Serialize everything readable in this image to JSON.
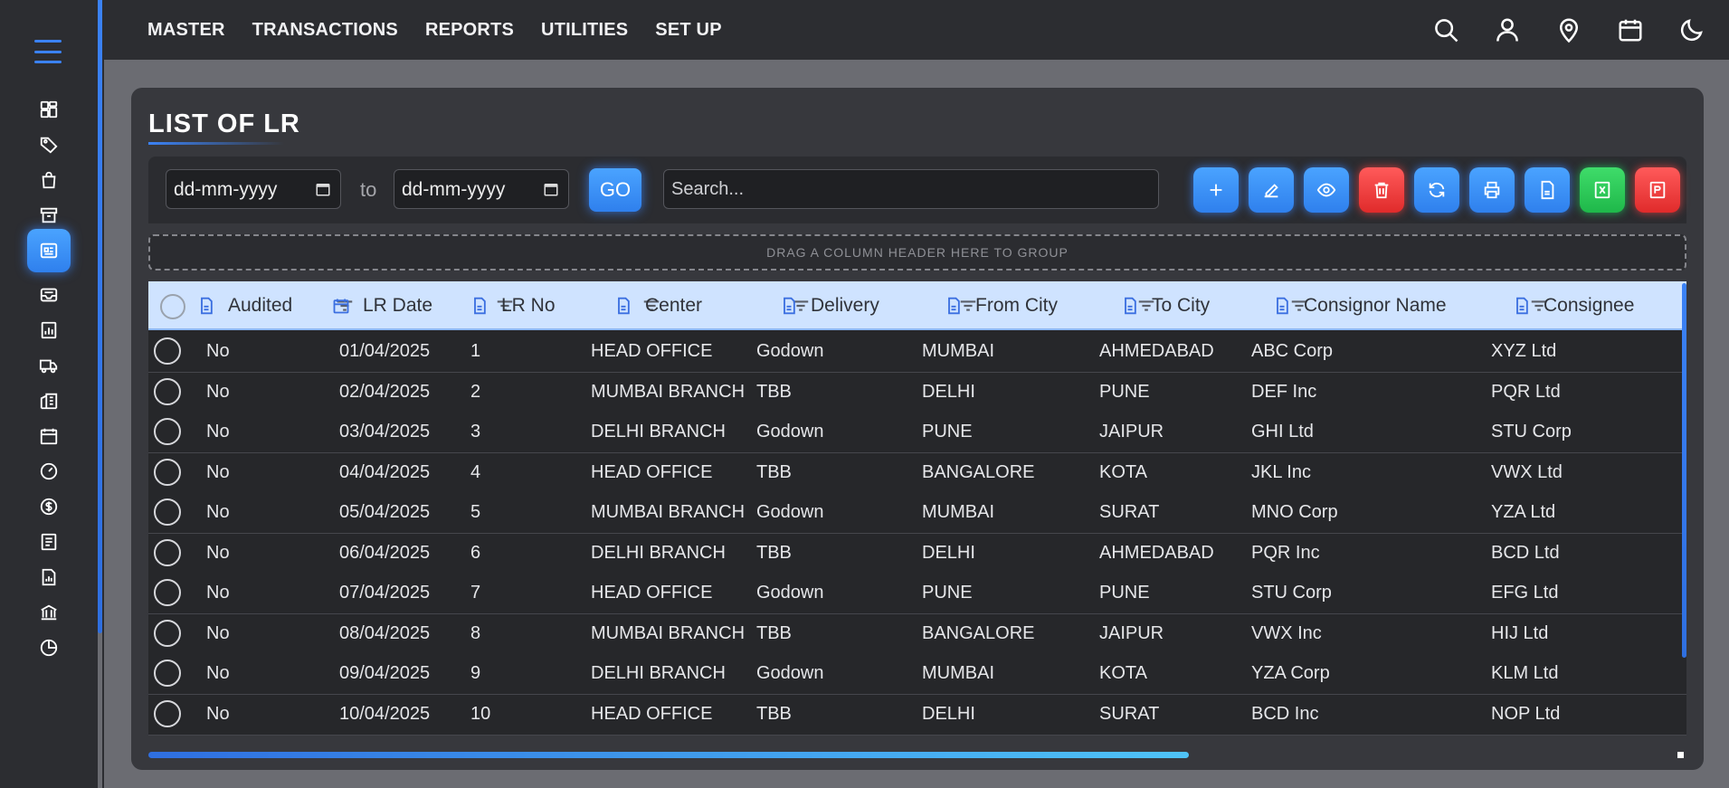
{
  "app": {
    "accent_color": "#3b82f6",
    "sidebar_icons": [
      "menu-icon",
      "dashboard-icon",
      "tag-icon",
      "bag-icon",
      "archive-icon",
      "document-list-icon",
      "inbox-icon",
      "report-icon",
      "truck-icon",
      "building-icon",
      "calendar-book-icon",
      "gauge-icon",
      "dollar-icon",
      "ledger-icon",
      "chart-doc-icon",
      "bank-icon",
      "pie-chart-icon"
    ]
  },
  "topbar": {
    "menu": [
      "MASTER",
      "TRANSACTIONS",
      "REPORTS",
      "UTILITIES",
      "SET UP"
    ],
    "icons": [
      "search-icon",
      "user-icon",
      "location-icon",
      "calendar-icon",
      "moon-icon"
    ]
  },
  "page": {
    "title": "LIST OF LR",
    "from_date_placeholder": "dd-mm-yyyy",
    "to_label": "to",
    "to_date_placeholder": "dd-mm-yyyy",
    "go_label": "GO",
    "search_placeholder": "Search...",
    "group_zone_text": "DRAG A COLUMN HEADER HERE TO GROUP",
    "actions": [
      "add-icon",
      "edit-icon",
      "view-icon",
      "delete-icon",
      "refresh-icon",
      "print-icon",
      "pdf-icon",
      "excel-icon",
      "report-icon"
    ]
  },
  "grid": {
    "columns": [
      "Audited",
      "LR Date",
      "LR No",
      "Center",
      "Delivery",
      "From City",
      "To City",
      "Consignor Name",
      "Consignee"
    ],
    "rows": [
      [
        "No",
        "01/04/2025",
        "1",
        "HEAD OFFICE",
        "Godown",
        "MUMBAI",
        "AHMEDABAD",
        "ABC Corp",
        "XYZ Ltd"
      ],
      [
        "No",
        "02/04/2025",
        "2",
        "MUMBAI BRANCH",
        "TBB",
        "DELHI",
        "PUNE",
        "DEF Inc",
        "PQR Ltd"
      ],
      [
        "No",
        "03/04/2025",
        "3",
        "DELHI BRANCH",
        "Godown",
        "PUNE",
        "JAIPUR",
        "GHI Ltd",
        "STU Corp"
      ],
      [
        "No",
        "04/04/2025",
        "4",
        "HEAD OFFICE",
        "TBB",
        "BANGALORE",
        "KOTA",
        "JKL Inc",
        "VWX Ltd"
      ],
      [
        "No",
        "05/04/2025",
        "5",
        "MUMBAI BRANCH",
        "Godown",
        "MUMBAI",
        "SURAT",
        "MNO Corp",
        "YZA Ltd"
      ],
      [
        "No",
        "06/04/2025",
        "6",
        "DELHI BRANCH",
        "TBB",
        "DELHI",
        "AHMEDABAD",
        "PQR Inc",
        "BCD Ltd"
      ],
      [
        "No",
        "07/04/2025",
        "7",
        "HEAD OFFICE",
        "Godown",
        "PUNE",
        "PUNE",
        "STU Corp",
        "EFG Ltd"
      ],
      [
        "No",
        "08/04/2025",
        "8",
        "MUMBAI BRANCH",
        "TBB",
        "BANGALORE",
        "JAIPUR",
        "VWX Inc",
        "HIJ Ltd"
      ],
      [
        "No",
        "09/04/2025",
        "9",
        "DELHI BRANCH",
        "Godown",
        "MUMBAI",
        "KOTA",
        "YZA Corp",
        "KLM Ltd"
      ],
      [
        "No",
        "10/04/2025",
        "10",
        "HEAD OFFICE",
        "TBB",
        "DELHI",
        "SURAT",
        "BCD Inc",
        "NOP Ltd"
      ]
    ]
  }
}
